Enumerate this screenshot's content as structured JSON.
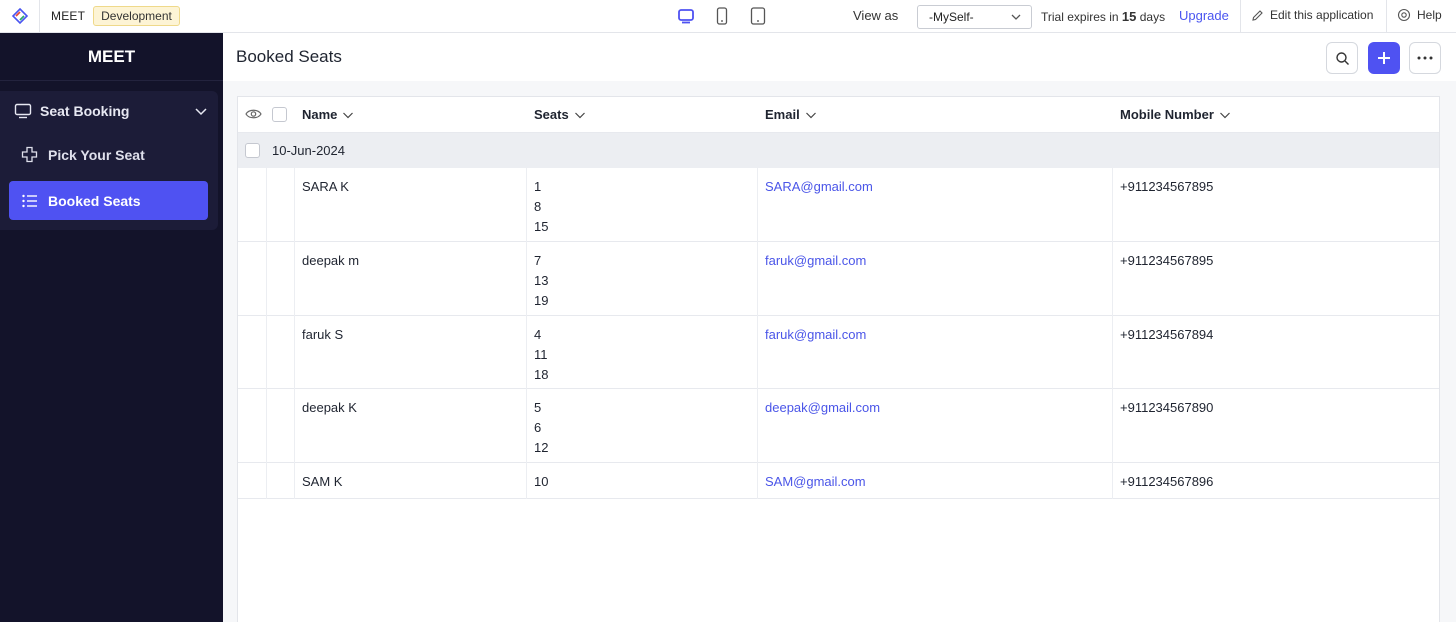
{
  "topbar": {
    "app_name": "MEET",
    "env_badge": "Development",
    "view_as_label": "View as",
    "view_as_value": "-MySelf-",
    "trial_prefix": "Trial expires in ",
    "trial_days": "15",
    "trial_suffix": " days",
    "upgrade": "Upgrade",
    "edit_app": "Edit this application",
    "help": "Help",
    "accent": "#4a55f0"
  },
  "sidebar": {
    "title": "MEET",
    "group_label": "Seat Booking",
    "items": [
      {
        "label": "Pick Your Seat",
        "icon": "seat-plus-icon",
        "active": false
      },
      {
        "label": "Booked Seats",
        "icon": "list-icon",
        "active": true
      }
    ],
    "bg": "#13132a",
    "active_color": "#4f52f2"
  },
  "main": {
    "title": "Booked Seats",
    "columns": [
      "Name",
      "Seats",
      "Email",
      "Mobile Number"
    ],
    "group_label": "10-Jun-2024",
    "rows": [
      {
        "name": "SARA K",
        "seats": [
          "1",
          "8",
          "15"
        ],
        "email": "SARA@gmail.com",
        "mobile": "+911234567895"
      },
      {
        "name": "deepak m",
        "seats": [
          "7",
          "13",
          "19"
        ],
        "email": "faruk@gmail.com",
        "mobile": "+911234567895"
      },
      {
        "name": "faruk S",
        "seats": [
          "4",
          "11",
          "18"
        ],
        "email": "faruk@gmail.com",
        "mobile": "+911234567894"
      },
      {
        "name": "deepak K",
        "seats": [
          "5",
          "6",
          "12"
        ],
        "email": "deepak@gmail.com",
        "mobile": "+911234567890"
      },
      {
        "name": "SAM K",
        "seats": [
          "10"
        ],
        "email": "SAM@gmail.com",
        "mobile": "+911234567896"
      }
    ]
  }
}
